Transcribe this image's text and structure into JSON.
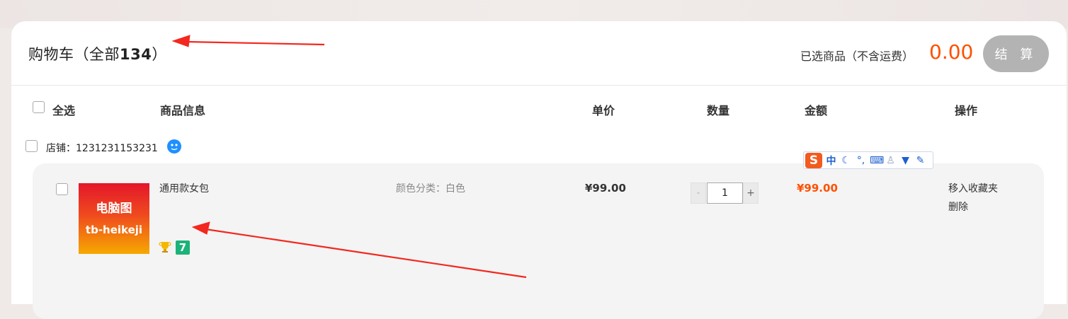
{
  "header": {
    "title_prefix": "购物车（全部",
    "count": "134",
    "title_suffix": "）",
    "selected_label": "已选商品（不含运费）",
    "selected_total": "0.00",
    "checkout_label": "结 算"
  },
  "columns": {
    "select_all": "全选",
    "product_info": "商品信息",
    "unit_price": "单价",
    "quantity": "数量",
    "amount": "金额",
    "actions": "操作"
  },
  "shop": {
    "label": "店铺：1231231153231",
    "chat_icon": "wangwang-chat-icon"
  },
  "item": {
    "thumb_line1": "电脑图",
    "thumb_line2": "tb-heikeji",
    "name": "通用款女包",
    "sku": "颜色分类：白色",
    "price": "¥99.00",
    "quantity": "1",
    "amount": "¥99.00",
    "minus": "-",
    "plus": "+",
    "move_to_favorites": "移入收藏夹",
    "delete": "删除",
    "badges": [
      "gold-trophy-icon",
      "seven-day-return-icon"
    ],
    "badge2_text": "7"
  },
  "ime_toolbar": {
    "logo": "S",
    "mode": "中",
    "icons": [
      "moon-icon",
      "punctuation-icon",
      "keyboard-icon",
      "user-icon",
      "shirt-icon",
      "wrench-icon"
    ]
  },
  "colors": {
    "accent": "#ff5000",
    "checkout_disabled": "#b3b3b3",
    "annotation_arrow": "#f3281e"
  }
}
